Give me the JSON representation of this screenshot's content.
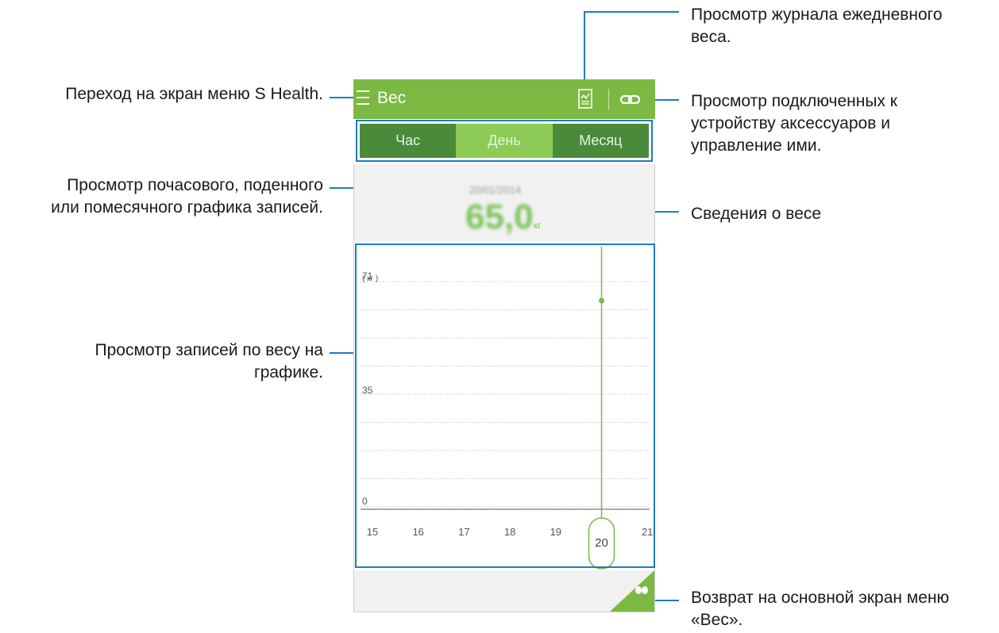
{
  "annotations": {
    "menu": "Переход на экран меню S Health.",
    "log_line1": "Просмотр журнала ежедневного",
    "log_line2": "веса.",
    "accessories_line1": "Просмотр подключенных к",
    "accessories_line2": "устройству аксессуаров и",
    "accessories_line3": "управление ими.",
    "tabs_line1": "Просмотр почасового, поденного",
    "tabs_line2": "или помесячного графика записей.",
    "weight_info": "Сведения о весе",
    "chart_line1": "Просмотр записей по весу на",
    "chart_line2": "графике.",
    "home_line1": "Возврат на основной экран меню",
    "home_line2": "«Вес»."
  },
  "appbar": {
    "title": "Вес",
    "menu_icon": "hamburger-menu-icon",
    "log_icon": "log-chart-icon",
    "link_icon": "accessory-link-icon",
    "color": "#7cb943"
  },
  "tabs": [
    {
      "label": "Час",
      "selected": false
    },
    {
      "label": "День",
      "selected": true
    },
    {
      "label": "Месяц",
      "selected": false
    }
  ],
  "weight_info": {
    "date": "20/01/2014",
    "value": "65,0",
    "unit": "кг"
  },
  "chart_data": {
    "type": "line",
    "x": [
      "15",
      "16",
      "17",
      "18",
      "19",
      "20",
      "21"
    ],
    "selected_x": "20",
    "y_ticks": [
      "0",
      "35",
      "71"
    ],
    "ylabel": "( кг )",
    "ylim": [
      0,
      71
    ],
    "series": [
      {
        "values": [
          null,
          null,
          null,
          null,
          null,
          65,
          null
        ]
      }
    ],
    "grid": true
  },
  "bottom": {
    "home_icon": "scale-footprints-icon",
    "accent": "#7cb943"
  },
  "colors": {
    "annotation_line": "#1f7cc0",
    "green": "#7cb943"
  }
}
